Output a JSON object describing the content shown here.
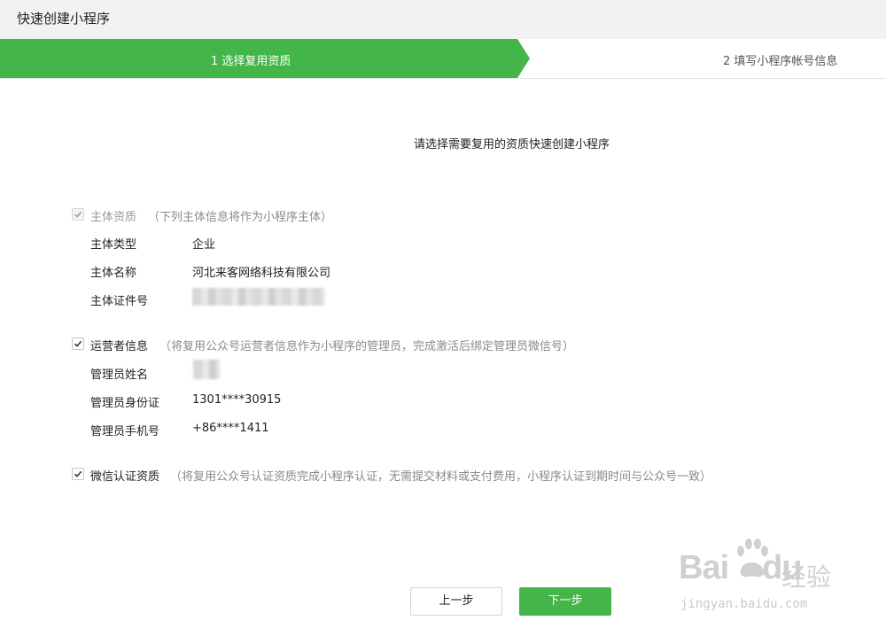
{
  "header": {
    "title": "快速创建小程序"
  },
  "steps": [
    {
      "label": "1 选择复用资质",
      "active": true
    },
    {
      "label": "2 填写小程序帐号信息",
      "active": false
    }
  ],
  "intro": "请选择需要复用的资质快速创建小程序",
  "sections": {
    "subject": {
      "title": "主体资质",
      "note": "（下列主体信息将作为小程序主体）",
      "checked": true,
      "disabled": true,
      "rows": [
        {
          "label": "主体类型",
          "value": "企业"
        },
        {
          "label": "主体名称",
          "value": "河北来客网络科技有限公司"
        },
        {
          "label": "主体证件号",
          "value": ""
        }
      ]
    },
    "operator": {
      "title": "运营者信息",
      "note": "（将复用公众号运营者信息作为小程序的管理员，完成激活后绑定管理员微信号）",
      "checked": true,
      "rows": [
        {
          "label": "管理员姓名",
          "value": ""
        },
        {
          "label": "管理员身份证",
          "value": "1301****30915"
        },
        {
          "label": "管理员手机号",
          "value": "+86****1411"
        }
      ]
    },
    "wechat": {
      "title": "微信认证资质",
      "note": "（将复用公众号认证资质完成小程序认证，无需提交材料或支付费用，小程序认证到期时间与公众号一致）",
      "checked": true
    }
  },
  "buttons": {
    "prev": "上一步",
    "next": "下一步"
  },
  "watermark": {
    "brand": "Bai",
    "brand2": "du",
    "cn": "经验",
    "url": "jingyan.baidu.com"
  },
  "colors": {
    "accent": "#44b549",
    "header_bg": "#f2f2f2"
  }
}
